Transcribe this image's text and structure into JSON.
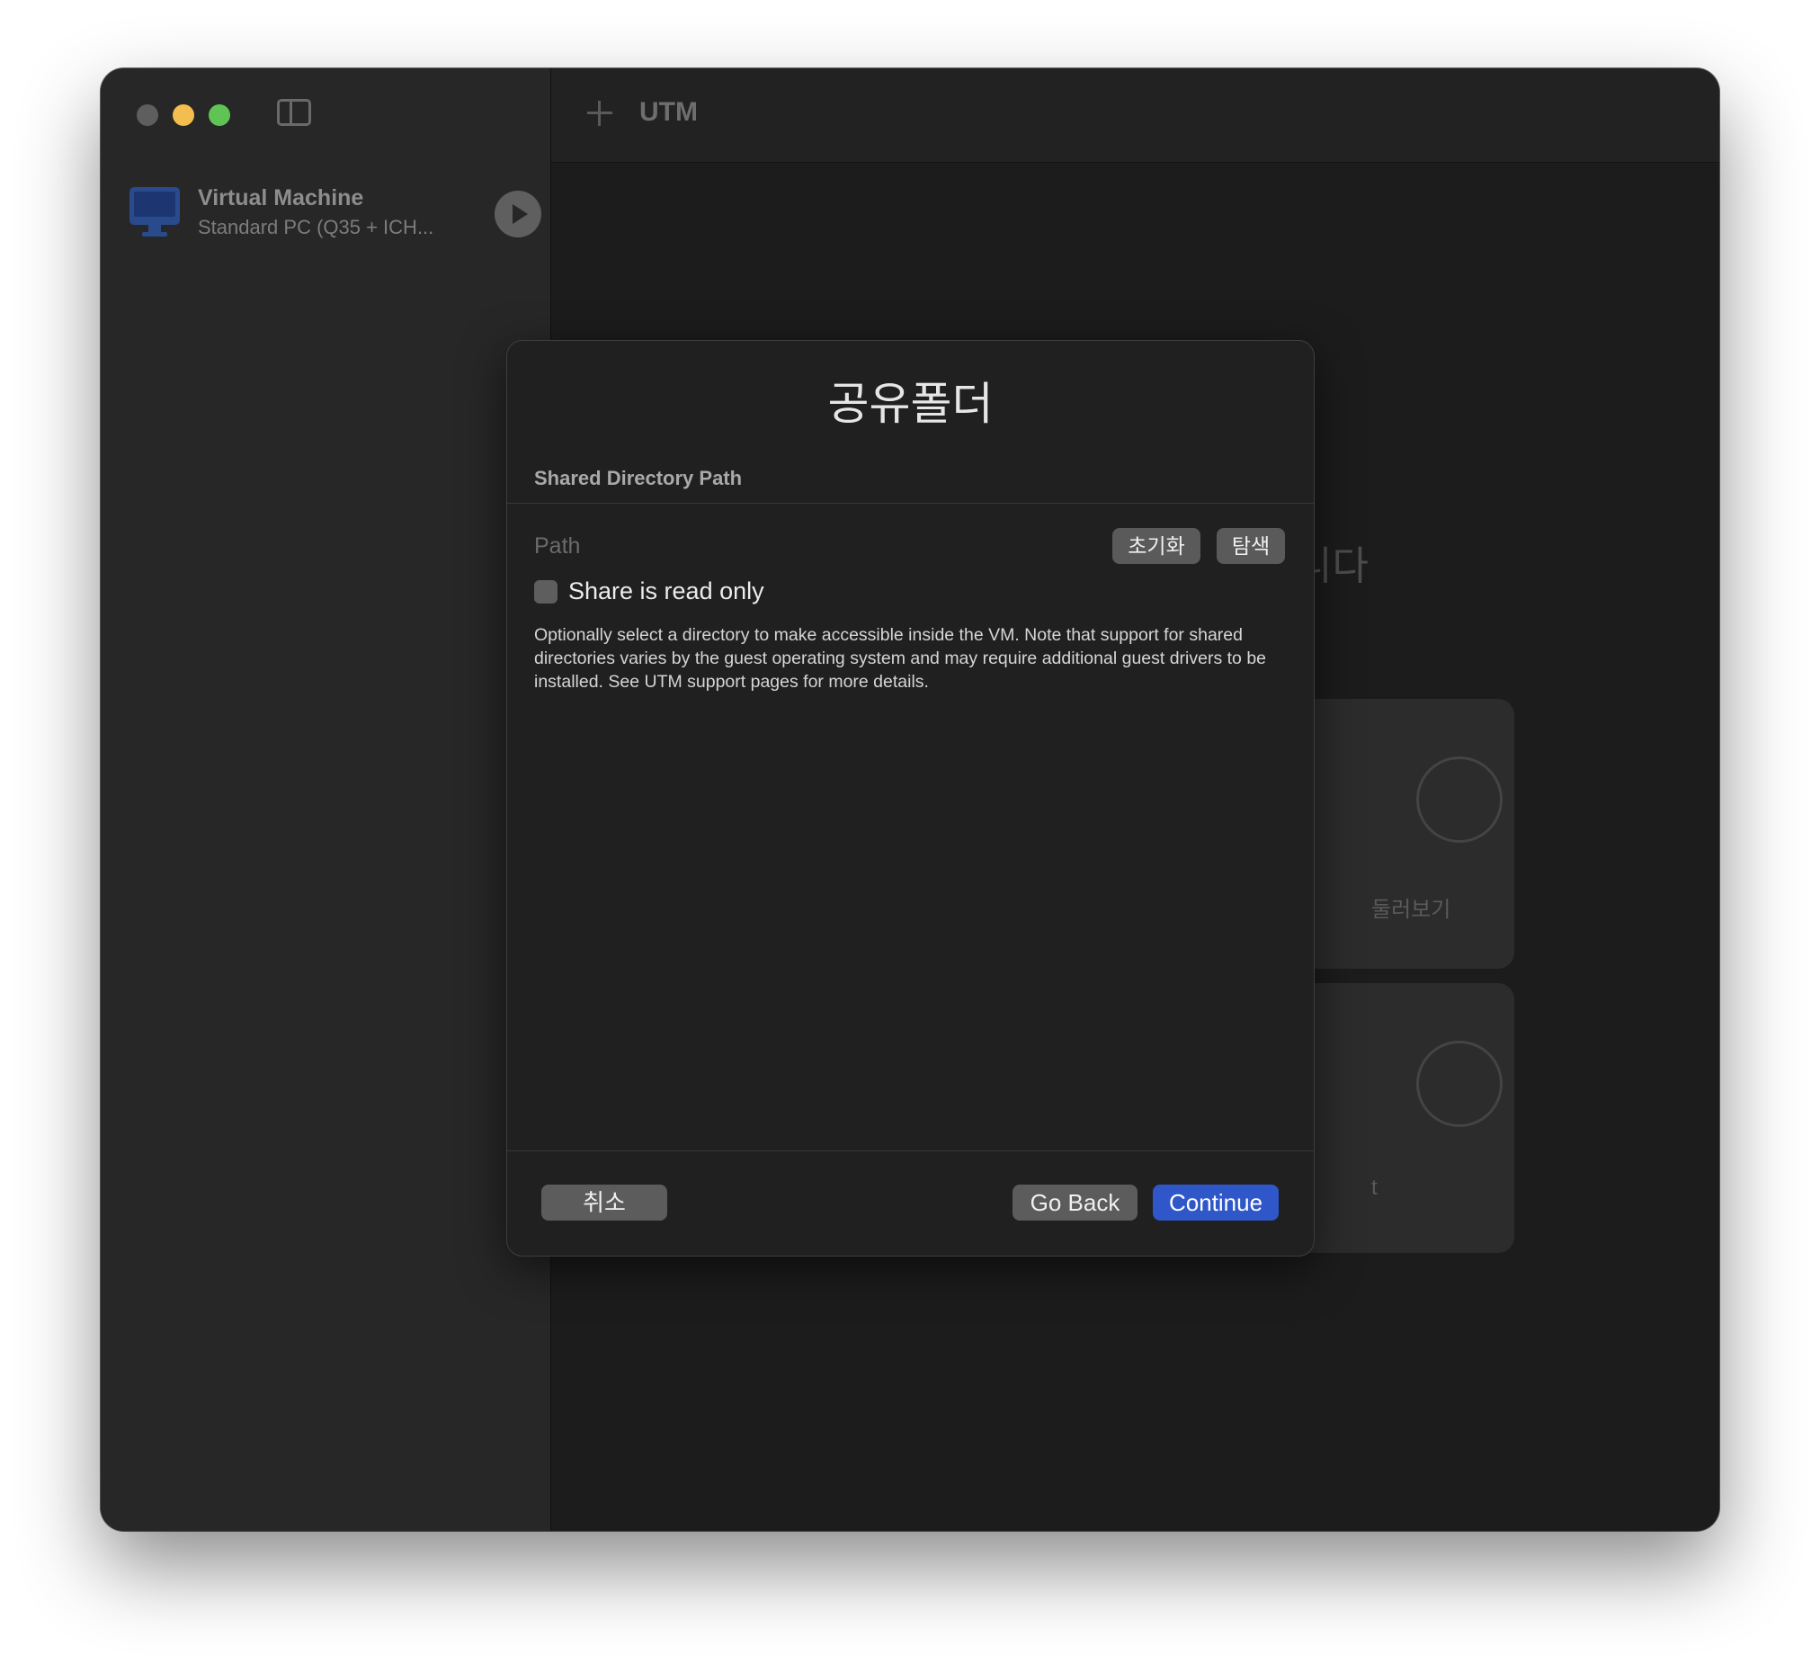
{
  "window": {
    "title": "UTM"
  },
  "sidebar": {
    "vm": {
      "name": "Virtual Machine",
      "description": "Standard PC (Q35 + ICH..."
    }
  },
  "background": {
    "welcome_partial": "니다",
    "card1_label": "둘러보기",
    "card2_label": "t"
  },
  "dialog": {
    "title": "공유폴더",
    "section_header": "Shared Directory Path",
    "path_label": "Path",
    "reset_button": "초기화",
    "browse_button": "탐색",
    "read_only_label": "Share is read only",
    "read_only_checked": false,
    "description": "Optionally select a directory to make accessible inside the VM. Note that support for shared directories varies by the guest operating system and may require additional guest drivers to be installed. See UTM support pages for more details.",
    "cancel_button": "취소",
    "back_button": "Go Back",
    "continue_button": "Continue"
  },
  "colors": {
    "accent": "#2f57c9",
    "traffic_close": "#5e5e5e",
    "traffic_minimize": "#f4bd4f",
    "traffic_maximize": "#5fc454"
  }
}
